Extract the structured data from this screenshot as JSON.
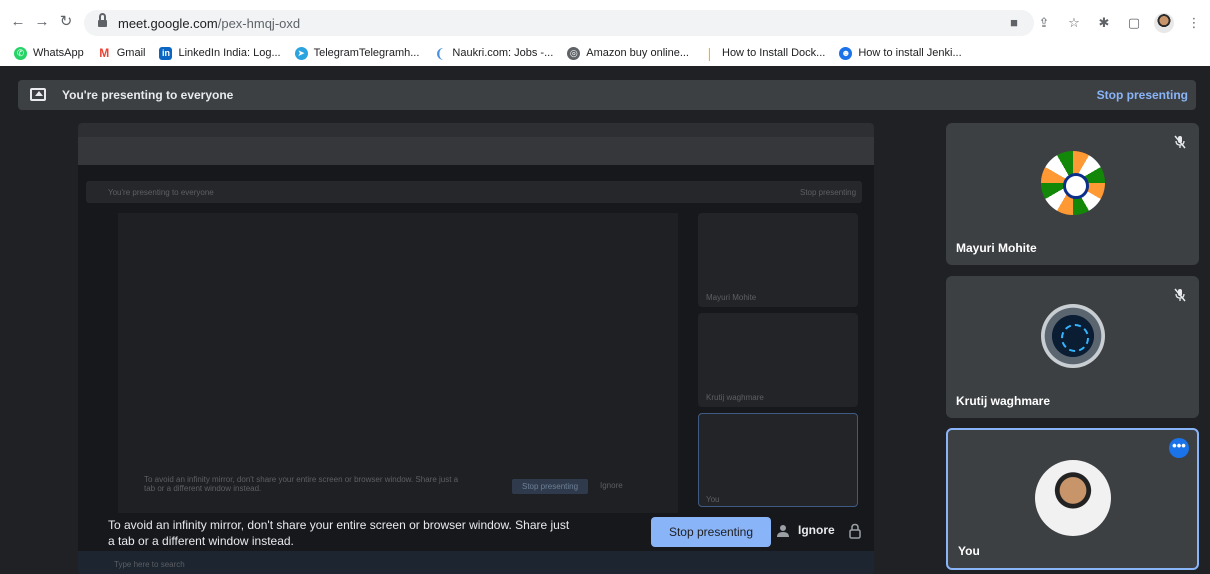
{
  "browser": {
    "url_host": "meet.google.com",
    "url_path": "/pex-hmqj-oxd",
    "bookmarks": [
      {
        "label": "WhatsApp",
        "icon": "whatsapp-icon",
        "color": "#25d366"
      },
      {
        "label": "Gmail",
        "icon": "gmail-icon",
        "color": "#ea4335"
      },
      {
        "label": "LinkedIn India: Log...",
        "icon": "linkedin-icon",
        "color": "#0a66c2"
      },
      {
        "label": "TelegramTelegramh...",
        "icon": "telegram-icon",
        "color": "#2aa3df"
      },
      {
        "label": "Naukri.com: Jobs -...",
        "icon": "naukri-icon",
        "color": "#4a90e2"
      },
      {
        "label": "Amazon buy online...",
        "icon": "globe-icon",
        "color": "#5f6368"
      },
      {
        "label": "How to Install Dock...",
        "icon": "bookmark-icon",
        "color": "#f4b400"
      },
      {
        "label": "How to install Jenki...",
        "icon": "jenkins-icon",
        "color": "#1a73e8"
      }
    ]
  },
  "meet": {
    "banner_text": "You're presenting to everyone",
    "stop_presenting_link": "Stop presenting",
    "participants": [
      {
        "name": "Mayuri Mohite",
        "avatar": "flag-avatar",
        "muted": true
      },
      {
        "name": "Krutij waghmare",
        "avatar": "fingerprint-avatar",
        "muted": true
      },
      {
        "name": "You",
        "avatar": "user-avatar",
        "muted": false
      }
    ],
    "warning_text": "To avoid an infinity mirror, don't share your entire screen or browser window. Share just a tab or a different window instead.",
    "stop_button": "Stop presenting",
    "ignore_button": "Ignore"
  },
  "mirror": {
    "banner_text": "You're presenting to everyone",
    "stop_link": "Stop presenting",
    "tiles": [
      "Mayuri Mohite",
      "Krutij waghmare",
      "You"
    ],
    "warning_text": "To avoid an infinity mirror, don't share your entire screen or browser window. Share just a tab or a different window instead.",
    "stop_button": "Stop presenting",
    "ignore_button": "Ignore",
    "search_placeholder": "Type here to search"
  },
  "colors": {
    "accent": "#8ab4f8",
    "speaking_border": "#8ab4f8",
    "meet_bg": "#202124",
    "tile_bg": "#3c4043"
  }
}
